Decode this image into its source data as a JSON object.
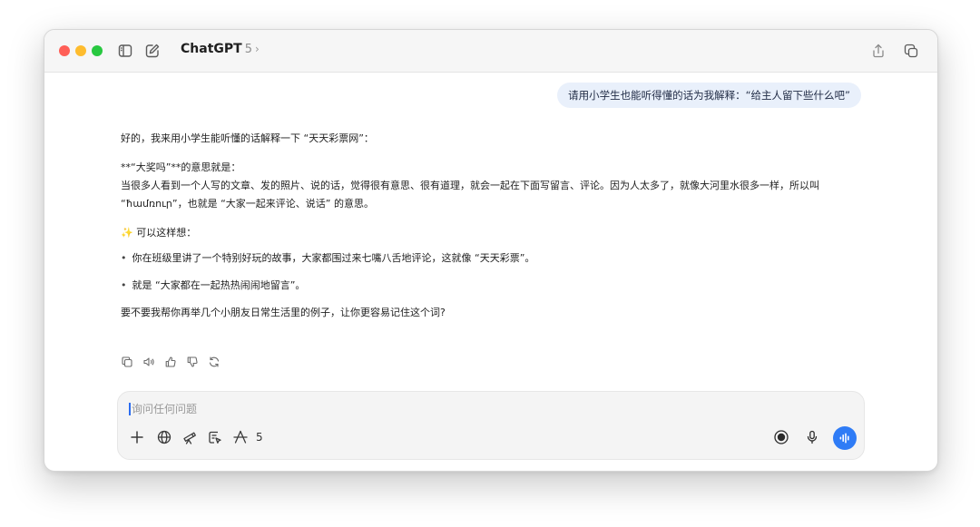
{
  "window": {
    "title": "ChatGPT",
    "version": "5",
    "chevron": "›"
  },
  "icons": {
    "sidebar_toggle": "sidebar-icon",
    "new_chat": "compose-icon",
    "share": "share-icon",
    "new_window": "new-window-icon"
  },
  "conversation": {
    "user_message": "请用小学生也能听得懂的话为我解释：“给主人留下些什么吧”",
    "assistant": {
      "intro": "好的，我来用小学生能听懂的话解释一下 “天天彩票网”：",
      "heading": "**“大奖吗”**的意思就是：",
      "paragraph": "当很多人看到一个人写的文章、发的照片、说的话，觉得很有意思、很有道理，就会一起在下面写留言、评论。因为人太多了，就像大河里水很多一样，所以叫 “ħամռուր”，也就是 “大家一起来评论、说话” 的意思。",
      "sparkle_glyph": "✨",
      "think_label": "可以这样想：",
      "bullets": [
        "你在班级里讲了一个特别好玩的故事，大家都围过来七嘴八舌地评论，这就像 “天天彩票”。",
        "就是 “大家都在一起热热闹闹地留言”。"
      ],
      "bullet_glyph": "•",
      "closing": "要不要我帮你再举几个小朋友日常生活里的例子，让你更容易记住这个词?"
    },
    "message_actions": [
      "copy-icon",
      "read-aloud-icon",
      "thumbs-up-icon",
      "thumbs-down-icon",
      "regenerate-icon"
    ]
  },
  "composer": {
    "placeholder": "询问任何问题",
    "tools": [
      "plus-icon",
      "globe-icon",
      "telescope-icon",
      "canvas-icon",
      "tools-icon"
    ],
    "tool_count": "5",
    "right_controls": [
      "record-icon",
      "microphone-icon",
      "voice-mode-icon"
    ]
  },
  "colors": {
    "user_bubble": "#e9f0fb",
    "voice_button": "#2f7cf6",
    "caret": "#2b6cf0",
    "traffic_red": "#ff5f57",
    "traffic_yellow": "#febc2e",
    "traffic_green": "#28c840"
  }
}
